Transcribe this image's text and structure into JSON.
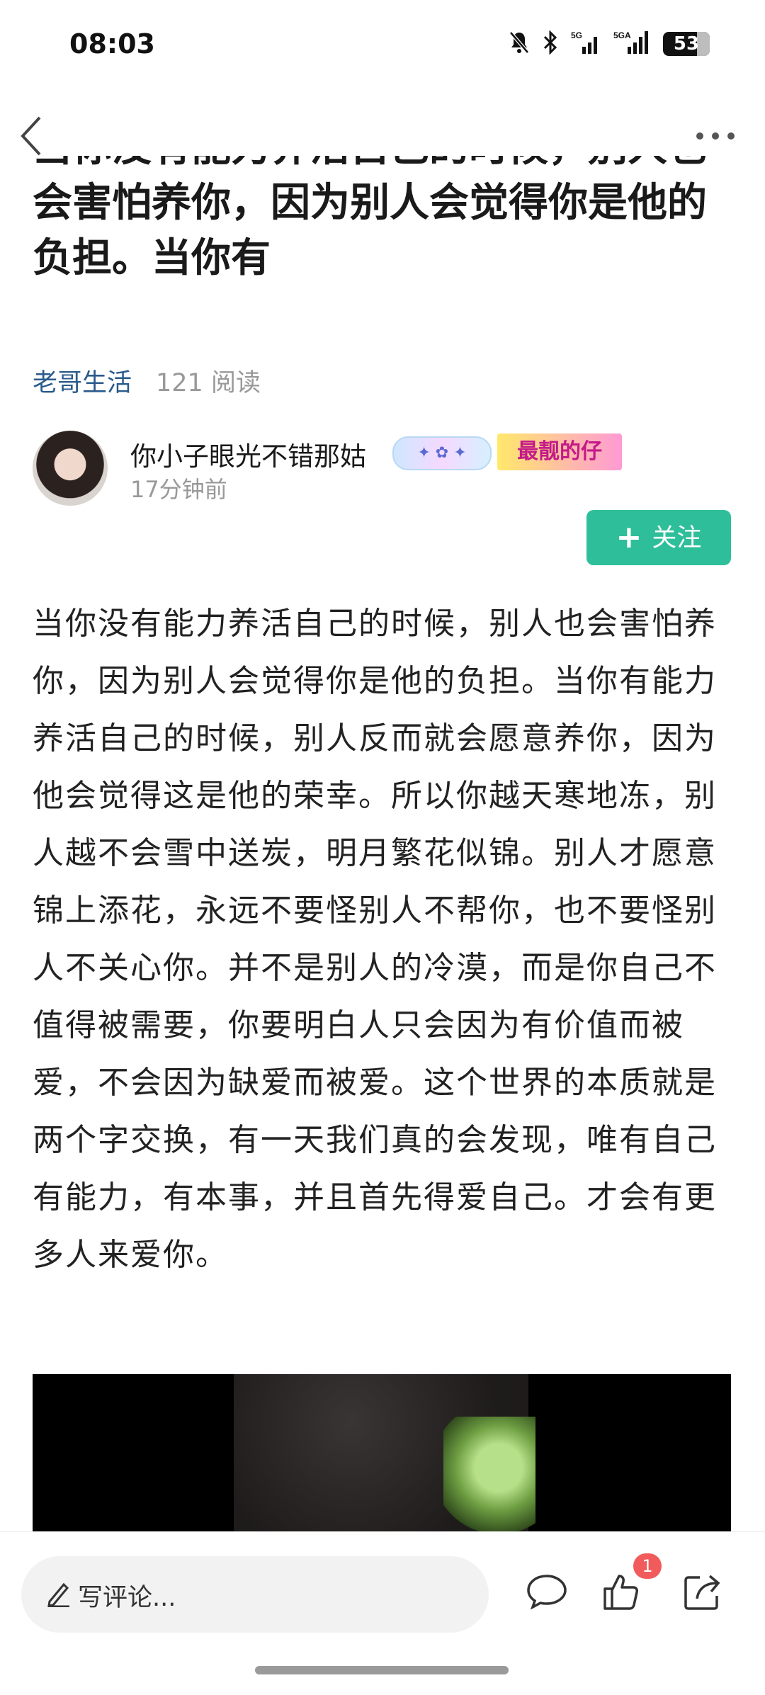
{
  "status_bar": {
    "time": "08:03",
    "network_labels": [
      "5G",
      "5GA"
    ],
    "battery": "53"
  },
  "nav": {
    "back_icon": "chevron-left-icon",
    "more_icon": "more-horizontal-icon"
  },
  "article": {
    "title": "当你没有能力养活自己的时候，别人也会害怕养你，因为别人会觉得你是他的负担。当你有",
    "source": "老哥生活",
    "reads": "121 阅读",
    "body": "当你没有能力养活自己的时候，别人也会害怕养你，因为别人会觉得你是他的负担。当你有能力养活自己的时候，别人反而就会愿意养你，因为他会觉得这是他的荣幸。所以你越天寒地冻，别人越不会雪中送炭，明月繁花似锦。别人才愿意锦上添花，永远不要怪别人不帮你，也不要怪别人不关心你。并不是别人的冷漠，而是你自己不值得被需要，你要明白人只会因为有价值而被爱，不会因为缺爱而被爱。这个世界的本质就是两个字交换，有一天我们真的会发现，唯有自己有能力，有本事，并且首先得爱自己。才会有更多人来爱你。"
  },
  "author": {
    "name": "你小子眼光不错那姑",
    "time": "17分钟前",
    "badge_secondary": "最靓的仔",
    "follow_label": "关注"
  },
  "bottom_bar": {
    "comment_placeholder": "写评论...",
    "like_count": "1"
  },
  "colors": {
    "accent": "#2ebf9a",
    "source_link": "#2a5b8c",
    "badge_red": "#f25b5b"
  }
}
